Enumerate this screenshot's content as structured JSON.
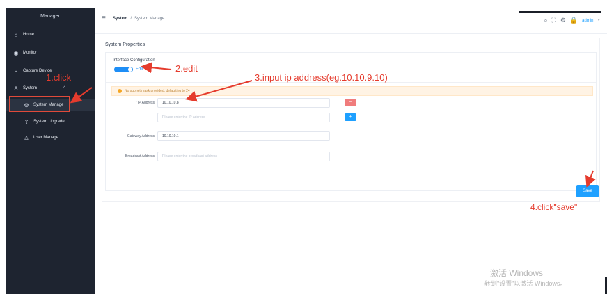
{
  "sidebar": {
    "brand": "Manager",
    "items": [
      {
        "label": "Home",
        "icon": "home-icon"
      },
      {
        "label": "Monitor",
        "icon": "monitor-icon"
      },
      {
        "label": "Capture Device",
        "icon": "search-icon"
      },
      {
        "label": "System",
        "icon": "user-icon"
      },
      {
        "label": "System Manage",
        "icon": "gear-icon"
      },
      {
        "label": "System Upgrade",
        "icon": "upload-icon"
      },
      {
        "label": "User Manage",
        "icon": "person-icon"
      }
    ]
  },
  "topbar": {
    "breadcrumb": {
      "root": "System",
      "sep": "/",
      "current": "System Manage"
    },
    "user": "admin"
  },
  "card": {
    "title": "System Properties",
    "interface_config": "Interface Configuration",
    "edit": "Edit",
    "warning": "No subnet mask provided, defaulting to 24",
    "fields": {
      "ip_label": "* IP Address",
      "ip_value": "10.10.10.8",
      "ip2_placeholder": "Please enter the IP address",
      "gateway_label": "Gateway Address",
      "gateway_value": "10.10.10.1",
      "broadcast_label": "Broadcast Address",
      "broadcast_placeholder": "Please enter the broadcast address"
    },
    "btn_minus": "−",
    "btn_plus": "+",
    "save": "Save"
  },
  "annotations": {
    "a1": "1.click",
    "a2": "2.edit",
    "a3": "3.input ip address(eg.10.10.9.10)",
    "a4": "4.click\"save\""
  },
  "watermark": {
    "line1": "激活 Windows",
    "line2": "转到\"设置\"以激活 Windows。"
  },
  "colors": {
    "accent": "#1ea0ff",
    "danger": "#f07c7c",
    "annotation": "#e53b2d",
    "sidebar": "#1e2430"
  }
}
